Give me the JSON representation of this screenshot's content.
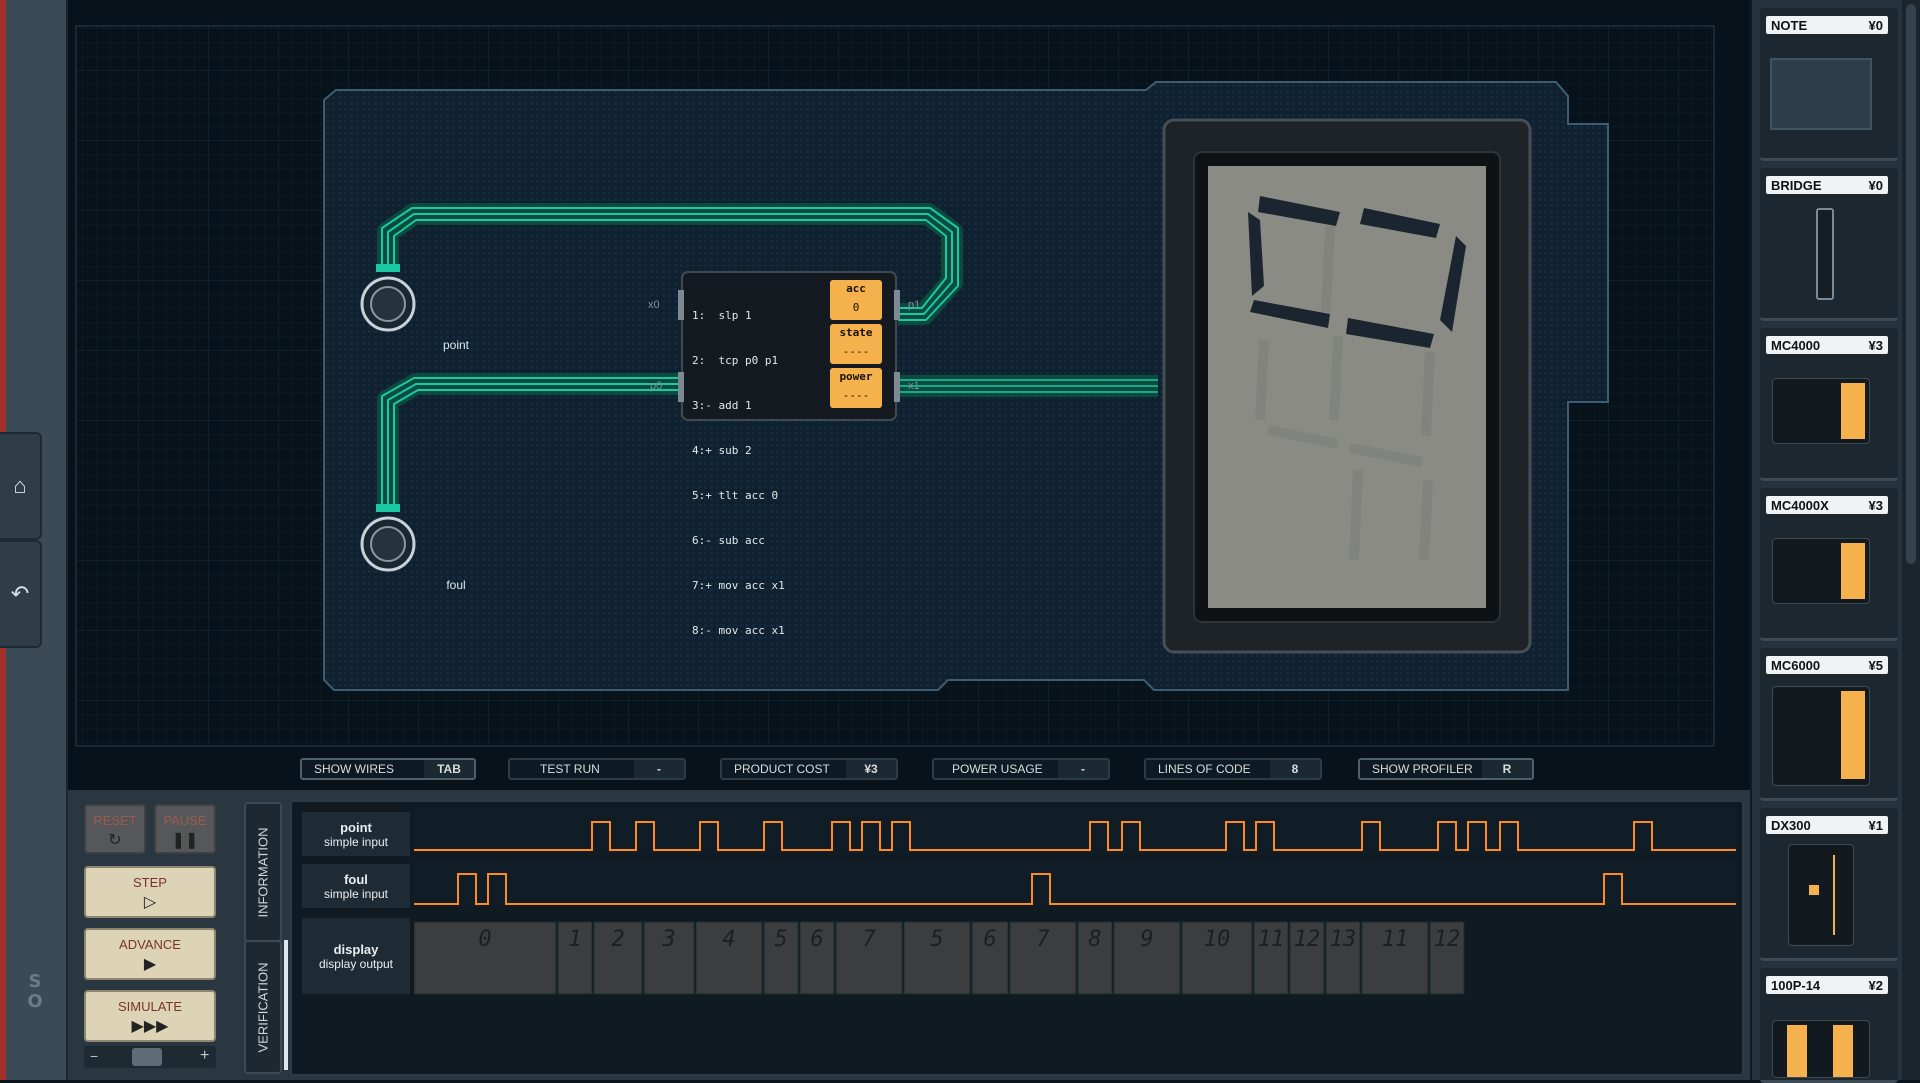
{
  "board": {
    "io_labels": {
      "point": "point",
      "foul": "foul"
    },
    "chip": {
      "ports": {
        "x0": "x0",
        "p0": "p0",
        "p1": "p1",
        "x1": "x1"
      },
      "code": [
        "1:  slp 1",
        "2:  tcp p0 p1",
        "3:- add 1",
        "4:+ sub 2",
        "5:+ tlt acc 0",
        "6:- sub acc",
        "7:+ mov acc x1",
        "8:- mov acc x1"
      ],
      "registers": [
        {
          "name": "acc",
          "value": "0"
        },
        {
          "name": "state",
          "value": "----"
        },
        {
          "name": "power",
          "value": "----"
        }
      ]
    }
  },
  "toolbar": {
    "show_wires": {
      "label": "SHOW WIRES",
      "value": "TAB"
    },
    "test_run": {
      "label": "TEST RUN",
      "value": "-"
    },
    "product_cost": {
      "label": "PRODUCT COST",
      "value": "¥3"
    },
    "power_usage": {
      "label": "POWER USAGE",
      "value": "-"
    },
    "lines_of_code": {
      "label": "LINES OF CODE",
      "value": "8"
    },
    "show_profiler": {
      "label": "SHOW PROFILER",
      "value": "R"
    }
  },
  "controls": {
    "reset": "RESET",
    "pause": "PAUSE",
    "step": "STEP",
    "advance": "ADVANCE",
    "simulate": "SIMULATE",
    "speed_minus": "−",
    "speed_plus": "+"
  },
  "tabs": {
    "information": "INFORMATION",
    "verification": "VERIFICATION"
  },
  "signals": [
    {
      "name": "point",
      "type": "simple input"
    },
    {
      "name": "foul",
      "type": "simple input"
    },
    {
      "name": "display",
      "type": "display output"
    }
  ],
  "display_digits": [
    "0",
    "1",
    "2",
    "3",
    "4",
    "5",
    "6",
    "7",
    "5",
    "6",
    "7",
    "8",
    "9",
    "10",
    "11",
    "12",
    "13",
    "11",
    "12"
  ],
  "palette": [
    {
      "name": "NOTE",
      "cost": "¥0"
    },
    {
      "name": "BRIDGE",
      "cost": "¥0"
    },
    {
      "name": "MC4000",
      "cost": "¥3"
    },
    {
      "name": "MC4000X",
      "cost": "¥3"
    },
    {
      "name": "MC6000",
      "cost": "¥5"
    },
    {
      "name": "DX300",
      "cost": "¥1"
    },
    {
      "name": "100P-14",
      "cost": "¥2"
    }
  ],
  "colors": {
    "wire": "#18c9a3",
    "trace": "#ff8a1e",
    "register": "#f5b14c",
    "accent_red": "#a3332a"
  },
  "icons": [
    "home-icon",
    "undo-icon",
    "reset-icon",
    "pause-icon",
    "step-icon",
    "advance-icon",
    "simulate-icon"
  ]
}
